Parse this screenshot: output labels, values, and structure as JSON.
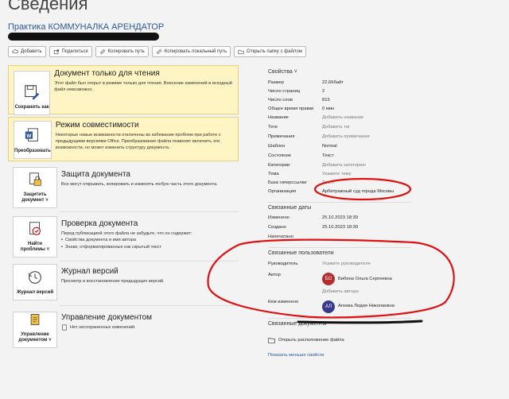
{
  "page": {
    "title": "Сведения"
  },
  "document": {
    "title": "Практика КОММУНАЛКА АРЕНДАТОР"
  },
  "toolbar": {
    "add": "Добавить",
    "share": "Поделиться",
    "copy_path": "Копировать путь",
    "copy_local_path": "Копировать локальный путь",
    "open_folder": "Открыть папку с файлом"
  },
  "cards": {
    "readonly": {
      "button": "Сохранить как",
      "heading": "Документ только для чтения",
      "text": "Этот файл был открыт в режиме только для чтения. Внесение изменений в исходный файл невозможно."
    },
    "compat": {
      "button": "Преобразовать",
      "heading": "Режим совместимости",
      "text": "Некоторые новые возможности отключены во избежание проблем при работе с предыдущими версиями Office. Преобразование файла позволит включить эти возможности, но может изменить структуру документа."
    },
    "protect": {
      "button_line1": "Защитить",
      "button_line2": "документ",
      "heading": "Защита документа",
      "text": "Все могут открывать, копировать и изменять любую часть этого документа."
    },
    "inspect": {
      "button_line1": "Найти",
      "button_line2": "проблемы",
      "heading": "Проверка документа",
      "text": "Перед публикацией этого файла не забудьте, что он содержит:",
      "bullets": [
        "Свойства документа и имя автора",
        "Знаки, отформатированные как скрытый текст"
      ]
    },
    "versions": {
      "button": "Журнал версий",
      "heading": "Журнал версий",
      "text": "Просмотр и восстановление предыдущих версий."
    },
    "manage": {
      "button_line1": "Управление",
      "button_line2": "документом",
      "heading": "Управление документом",
      "text": "Нет несохраненных изменений."
    }
  },
  "properties": {
    "header": "Свойства",
    "size": {
      "label": "Размер",
      "value": "22,6Кбайт"
    },
    "pages": {
      "label": "Число страниц",
      "value": "2"
    },
    "words": {
      "label": "Число слов",
      "value": "815"
    },
    "edit_time": {
      "label": "Общее время правки",
      "value": "0 мин"
    },
    "name": {
      "label": "Название",
      "value": "Добавить название"
    },
    "tags": {
      "label": "Теги",
      "value": "Добавить тег"
    },
    "comments": {
      "label": "Примечания",
      "value": "Добавить примечания"
    },
    "template": {
      "label": "Шаблон",
      "value": "Normal"
    },
    "status": {
      "label": "Состояние",
      "value": "Текст"
    },
    "categories": {
      "label": "Категории",
      "value": "Добавить категорию"
    },
    "subject": {
      "label": "Тема",
      "value": "Укажите тему"
    },
    "hyperlink_base": {
      "label": "База гиперссылки",
      "value": "Текст"
    },
    "company": {
      "label": "Организация",
      "value": "Арбитражный суд города Москвы"
    }
  },
  "dates": {
    "header": "Связанные даты",
    "modified": {
      "label": "Изменено",
      "value": "25.10.2023 18:39"
    },
    "created": {
      "label": "Создано",
      "value": "25.10.2023 18:39"
    },
    "printed": {
      "label": "Напечатано",
      "value": ""
    }
  },
  "people": {
    "header": "Связанные пользователи",
    "manager": {
      "label": "Руководитель",
      "value": "Укажите руководителя"
    },
    "author": {
      "label": "Автор",
      "initials": "БО",
      "name": "Бибина Ольга Сергеевна",
      "add": "Добавить автора"
    },
    "modified_by": {
      "label": "Кем изменено",
      "initials": "АЛ",
      "name": "Агеева Лидия Николаевна"
    }
  },
  "related_docs": {
    "header": "Связанные документы",
    "open_location": "Открыть расположение файла",
    "show_fewer": "Показать меньше свойств"
  },
  "colors": {
    "accent": "#2b579a",
    "readonly_bg": "#fff4c3",
    "author_avatar": "#b52c2c",
    "modifier_avatar": "#3a3a8c",
    "annotation": "#e01010"
  }
}
